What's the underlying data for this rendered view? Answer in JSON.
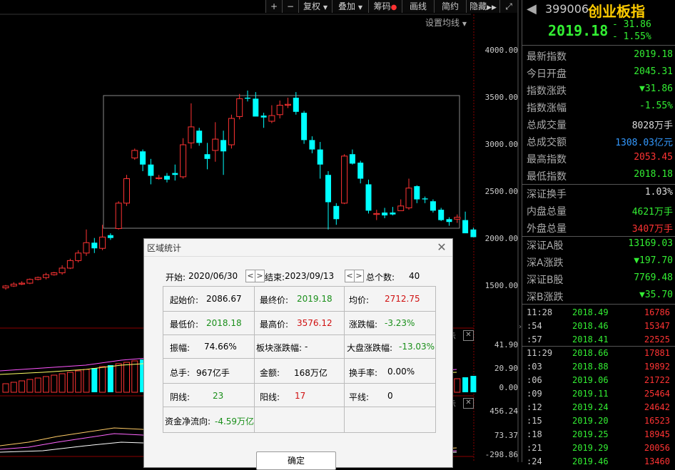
{
  "toolbar": {
    "plus": "+",
    "minus": "−",
    "fuquan": "复权",
    "diejia": "叠加",
    "chouma": "筹码",
    "huaxian": "画线",
    "tongyue": "简约",
    "yincang": "隐藏"
  },
  "ma_settings": "设置均线",
  "colors": {
    "up": "#ff3333",
    "down": "#00ffff",
    "bg": "#000000",
    "green": "#33ee33"
  },
  "price_axis": [
    "4000.00",
    "3500.00",
    "3000.00",
    "2500.00",
    "2000.00",
    "1500.00"
  ],
  "vol_axis": [
    "41.90",
    "20.90",
    "0.00"
  ],
  "ind_axis": [
    "456.24",
    "73.37",
    "-298.86"
  ],
  "panel_marks": [
    "示",
    "示"
  ],
  "chart_data": {
    "type": "candlestick",
    "selection": {
      "start": "2020/06/30",
      "end": "2023/09/13",
      "high": 3576.12,
      "low": 2018.18
    },
    "candles": [
      [
        1480,
        1500,
        1460,
        1510
      ],
      [
        1500,
        1520,
        1490,
        1540
      ],
      [
        1520,
        1530,
        1510,
        1550
      ],
      [
        1530,
        1570,
        1520,
        1580
      ],
      [
        1570,
        1590,
        1560,
        1600
      ],
      [
        1590,
        1620,
        1570,
        1640
      ],
      [
        1620,
        1640,
        1610,
        1650
      ],
      [
        1640,
        1690,
        1620,
        1720
      ],
      [
        1690,
        1770,
        1680,
        1790
      ],
      [
        1770,
        1850,
        1750,
        1880
      ],
      [
        1850,
        1960,
        1820,
        2100
      ],
      [
        1960,
        1900,
        1850,
        2010
      ],
      [
        1900,
        2020,
        1880,
        2150
      ],
      [
        2040,
        2010,
        1990,
        2060
      ],
      [
        2110,
        2380,
        2100,
        2400
      ],
      [
        2380,
        2640,
        2350,
        2680
      ],
      [
        2860,
        2940,
        2840,
        2960
      ],
      [
        2930,
        2790,
        2720,
        2950
      ],
      [
        2790,
        2670,
        2580,
        2850
      ],
      [
        2640,
        2650,
        2630,
        2680
      ],
      [
        2670,
        2630,
        2600,
        2700
      ],
      [
        2700,
        2680,
        2620,
        2790
      ],
      [
        2660,
        3000,
        2640,
        3070
      ],
      [
        3020,
        3190,
        2960,
        3440
      ],
      [
        3150,
        3020,
        2990,
        3180
      ],
      [
        2900,
        2850,
        2740,
        3020
      ],
      [
        2940,
        3060,
        2820,
        3240
      ],
      [
        3050,
        2930,
        2680,
        3150
      ],
      [
        3000,
        3280,
        2960,
        3320
      ],
      [
        3300,
        3490,
        3270,
        3540
      ],
      [
        3500,
        3490,
        3460,
        3576
      ],
      [
        3490,
        3300,
        3310,
        3560
      ],
      [
        3310,
        3290,
        3180,
        3340
      ],
      [
        3250,
        3310,
        3230,
        3420
      ],
      [
        3320,
        3420,
        3280,
        3470
      ],
      [
        3420,
        3430,
        3390,
        3500
      ],
      [
        3500,
        3350,
        3320,
        3560
      ],
      [
        3340,
        3050,
        3010,
        3360
      ],
      [
        3050,
        2950,
        2910,
        3090
      ],
      [
        2950,
        2790,
        2640,
        3030
      ],
      [
        2680,
        2390,
        2100,
        2720
      ],
      [
        2350,
        2210,
        2150,
        2380
      ],
      [
        2380,
        2880,
        2370,
        2900
      ],
      [
        2900,
        2800,
        2790,
        2950
      ],
      [
        2810,
        2640,
        2590,
        2830
      ],
      [
        2580,
        2300,
        2270,
        2630
      ],
      [
        2260,
        2270,
        2200,
        2310
      ],
      [
        2280,
        2250,
        2220,
        2330
      ],
      [
        2280,
        2260,
        2250,
        2340
      ],
      [
        2300,
        2350,
        2300,
        2420
      ],
      [
        2330,
        2540,
        2310,
        2640
      ],
      [
        2560,
        2420,
        2380,
        2570
      ],
      [
        2430,
        2420,
        2380,
        2450
      ],
      [
        2400,
        2300,
        2280,
        2420
      ],
      [
        2310,
        2200,
        2190,
        2330
      ],
      [
        2210,
        2180,
        2140,
        2230
      ],
      [
        2210,
        2230,
        2170,
        2260
      ],
      [
        2200,
        2060,
        2130,
        2290
      ],
      [
        2100,
        2019,
        2018,
        2120
      ]
    ]
  },
  "right_panel": {
    "code": "399006",
    "name": "创业板指",
    "price": "2019.18",
    "change": "- 31.86",
    "change_pct": "- 1.55%",
    "stats": [
      {
        "label": "最新指数",
        "value": "2019.18",
        "color": "#33ee33"
      },
      {
        "label": "今日开盘",
        "value": "2045.31",
        "color": "#33ee33"
      },
      {
        "label": "指数涨跌",
        "value": "▼31.86",
        "color": "#33ee33"
      },
      {
        "label": "指数涨幅",
        "value": "-1.55%",
        "color": "#33ee33"
      },
      {
        "label": "总成交量",
        "value": "8028万手",
        "color": "#dddddd"
      },
      {
        "label": "总成交额",
        "value": "1308.03亿元",
        "color": "#3399ff"
      },
      {
        "label": "最高指数",
        "value": "2053.45",
        "color": "#ff3333"
      },
      {
        "label": "最低指数",
        "value": "2018.18",
        "color": "#33ee33"
      }
    ],
    "stats2": [
      {
        "label": "深证换手",
        "value": "1.03%",
        "color": "#dddddd"
      },
      {
        "label": "内盘总量",
        "value": "4621万手",
        "color": "#33ee33"
      },
      {
        "label": "外盘总量",
        "value": "3407万手",
        "color": "#ff3333"
      }
    ],
    "stats3": [
      {
        "label": "深证A股",
        "value": "13169.03",
        "color": "#33ee33"
      },
      {
        "label": "深A涨跌",
        "value": "▼197.70",
        "color": "#33ee33"
      },
      {
        "label": "深证B股",
        "value": "7769.48",
        "color": "#33ee33"
      },
      {
        "label": "深B涨跌",
        "value": "▼35.70",
        "color": "#33ee33"
      }
    ],
    "ticks1": [
      {
        "time": "11:28",
        "price": "2018.49",
        "vol": "16786"
      },
      {
        "time": ":54",
        "price": "2018.46",
        "vol": "15347"
      },
      {
        "time": ":57",
        "price": "2018.41",
        "vol": "22525"
      }
    ],
    "ticks2": [
      {
        "time": "11:29",
        "price": "2018.66",
        "vol": "17881"
      },
      {
        "time": ":03",
        "price": "2018.88",
        "vol": "19892"
      },
      {
        "time": ":06",
        "price": "2019.06",
        "vol": "21722"
      },
      {
        "time": ":09",
        "price": "2019.11",
        "vol": "25464"
      },
      {
        "time": ":12",
        "price": "2019.24",
        "vol": "24642"
      },
      {
        "time": ":15",
        "price": "2019.20",
        "vol": "16523"
      },
      {
        "time": ":18",
        "price": "2019.25",
        "vol": "18945"
      },
      {
        "time": ":21",
        "price": "2019.29",
        "vol": "20056"
      },
      {
        "time": ":24",
        "price": "2019.46",
        "vol": "13460"
      }
    ]
  },
  "dialog": {
    "title": "区域统计",
    "start_label": "开始:",
    "start_date": "2020/06/30",
    "end_label": "结束:",
    "end_date": "2023/09/13",
    "count_label": "总个数:",
    "count": "40",
    "prev": "<",
    "next": ">",
    "start_price_label": "起始价:",
    "start_price": "2086.67",
    "end_price_label": "最终价:",
    "end_price": "2019.18",
    "avg_label": "均价:",
    "avg": "2712.75",
    "low_label": "最低价:",
    "low": "2018.18",
    "high_label": "最高价:",
    "high": "3576.12",
    "chg_label": "涨跌幅:",
    "chg": "-3.23%",
    "amp_label": "振幅:",
    "amp": "74.66%",
    "sector_label": "板块涨跌幅:",
    "sector": "-",
    "market_label": "大盘涨跌幅:",
    "market": "-13.03%",
    "vol_label": "总手:",
    "vol": "967亿手",
    "amt_label": "金额:",
    "amt": "168万亿",
    "turnover_label": "换手率:",
    "turnover": "0.00%",
    "down_label": "阴线:",
    "down": "23",
    "up_label": "阳线:",
    "up": "17",
    "flat_label": "平线:",
    "flat": "0",
    "flow_label": "资金净流向:",
    "flow": "-4.59万亿",
    "ok": "确定"
  }
}
